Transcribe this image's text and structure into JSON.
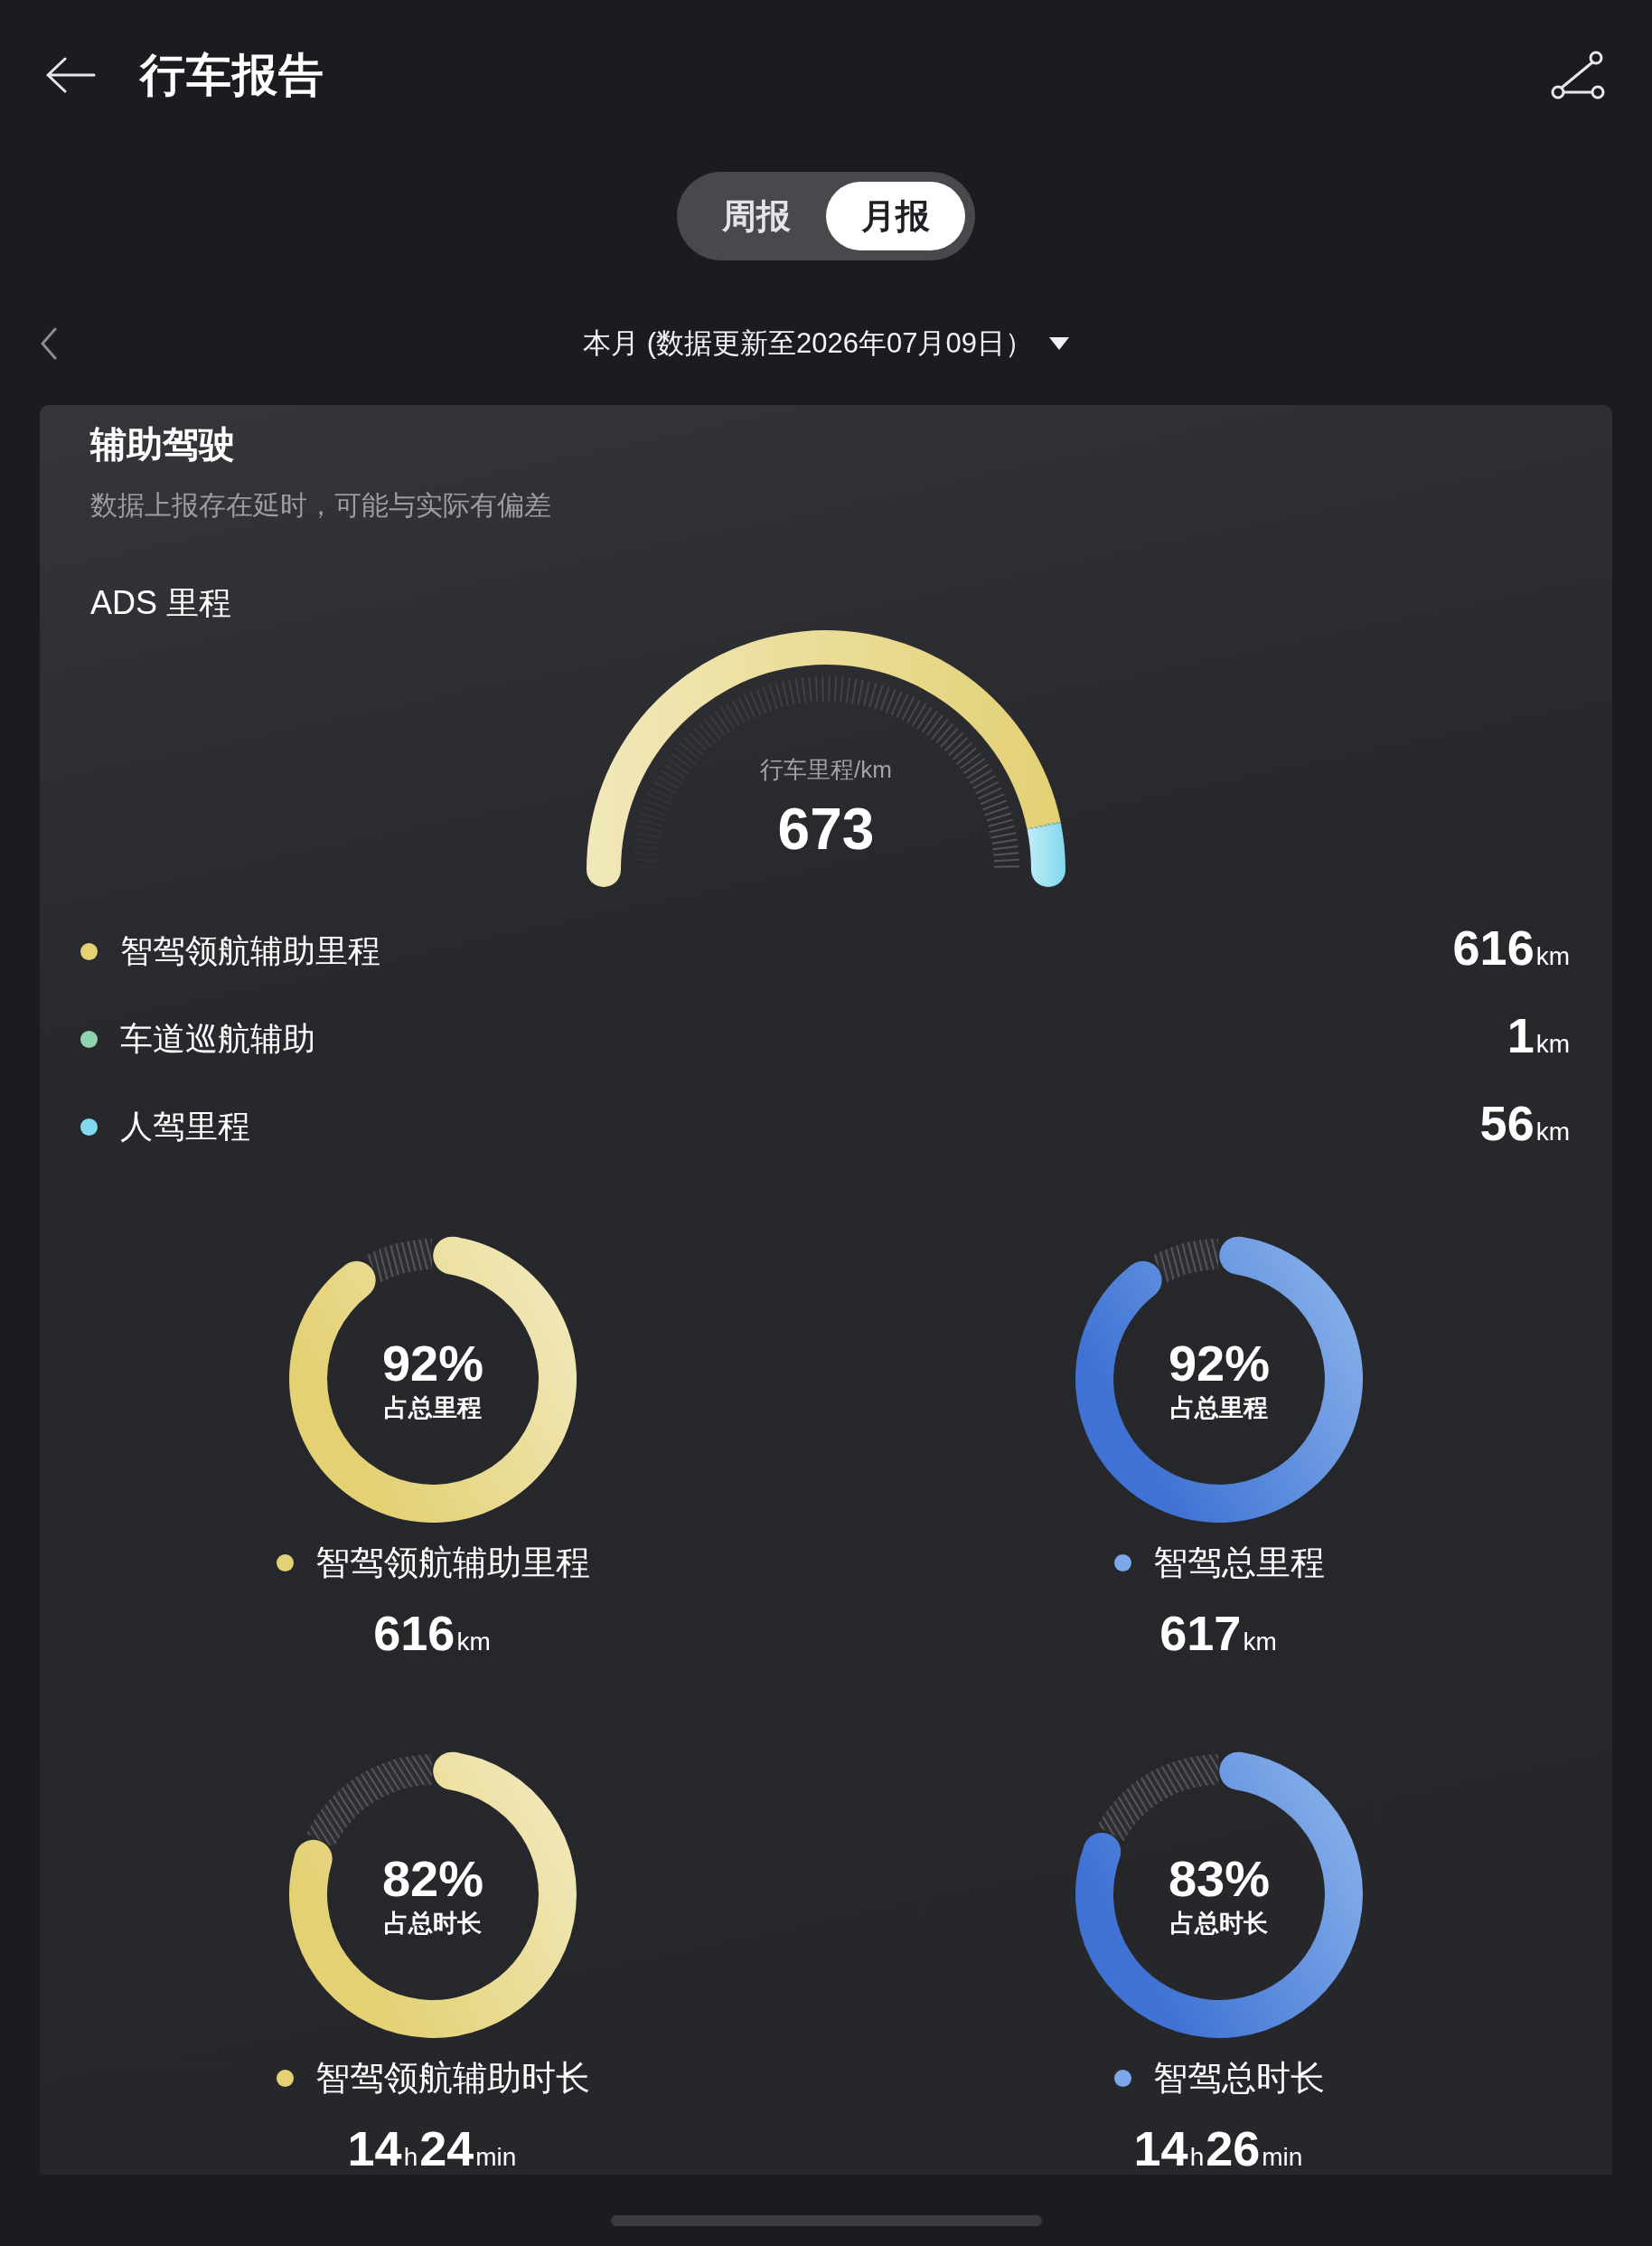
{
  "header": {
    "title": "行车报告"
  },
  "period_tabs": [
    {
      "label": "周报",
      "selected": false
    },
    {
      "label": "月报",
      "selected": true
    }
  ],
  "date_selector": {
    "label": "本月 (数据更新至2026年07月09日）"
  },
  "card": {
    "title": "辅助驾驶",
    "subtitle": "数据上报存在延时，可能与实际有偏差",
    "section_title": "ADS 里程",
    "gauge": {
      "caption": "行车里程/km",
      "total": "673",
      "chart_data": {
        "type": "donut",
        "categories": [
          "智驾领航辅助里程",
          "车道巡航辅助",
          "人驾里程"
        ],
        "values": [
          91.53,
          0.15,
          8.32
        ]
      }
    },
    "legend": [
      {
        "value": "616$_{km}$",
        "color": "#e3d174"
      },
      {
        "value": "1$_{km}$",
        "color": "#8fd4ae"
      },
      {
        "value": "56$_{km}$",
        "color": "#82d8ee"
      }
    ],
    "rings": [
      {
        "percent": "92%",
        "caption": "占总里程",
        "chart_data": {
          "type": "donut",
          "values": [
            92,
            8
          ]
        },
        "color": "#e3d174",
        "label": "智驾领航辅助里程",
        "value": "616$_{km}$"
      },
      {
        "percent": "92%",
        "caption": "占总里程",
        "chart_data": {
          "type": "donut",
          "values": [
            92,
            8
          ]
        },
        "color": "#7aa8e8",
        "label": "智驾总里程",
        "value": "617$_{km}$"
      },
      {
        "percent": "82%",
        "caption": "占总时长",
        "chart_data": {
          "type": "donut",
          "values": [
            82,
            18
          ]
        },
        "color": "#e3d174",
        "label": "智驾领航辅助时长",
        "value": "14$_{h}$24$_{min}$"
      },
      {
        "percent": "83%",
        "caption": "占总时长",
        "chart_data": {
          "type": "donut",
          "values": [
            83,
            17
          ]
        },
        "color": "#7aa8e8",
        "label": "智驾总时长",
        "value": "14$_{h}$26$_{min}$"
      }
    ]
  }
}
